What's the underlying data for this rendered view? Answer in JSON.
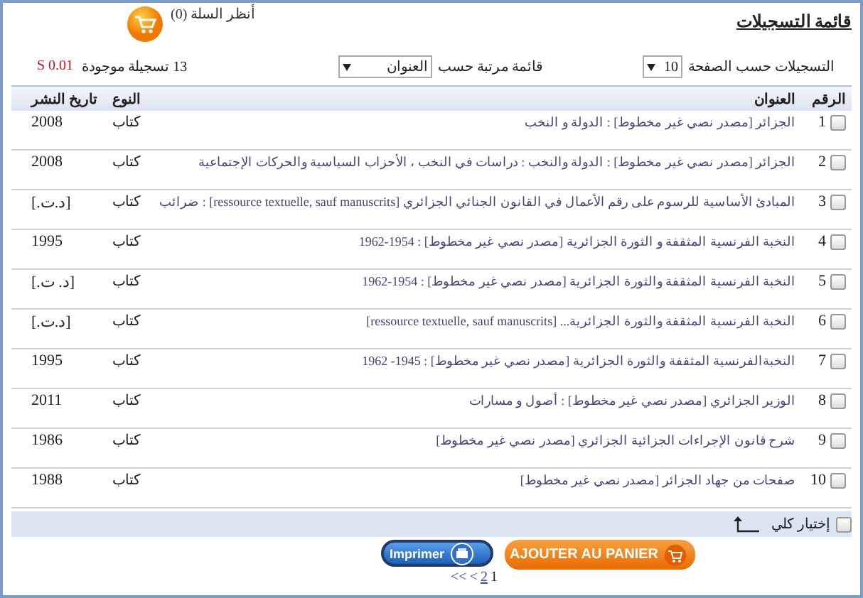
{
  "header": {
    "title": "قائمة التسجيلات",
    "cart_link": "أنظر السلة (0)"
  },
  "controls": {
    "per_page_label": "التسجيلات حسب الصفحة",
    "per_page_value": "10",
    "sort_label": "قائمة مرتبة حسب",
    "sort_value": "العنوان",
    "count": "13 تسجيلة موجودة",
    "time": "S 0.01"
  },
  "table": {
    "columns": [
      "الرقم",
      "العنوان",
      "النوع",
      "تاريخ النشر"
    ],
    "rows": [
      {
        "checked": false,
        "number": "1",
        "title": "الجزائر [مصدر نصي غير مخطوط] : الدولة و النخب",
        "type": "كتاب",
        "date": "2008"
      },
      {
        "checked": false,
        "number": "2",
        "title": "الجزائر [مصدر نصي غير مخطوط] : الدولة والنخب : دراسات في النخب ، الأحزاب السياسية والحركات الإجتماعية",
        "type": "كتاب",
        "date": "2008"
      },
      {
        "checked": false,
        "number": "3",
        "title": "المبادئ الأساسية للرسوم على رقم الأعمال في القانون الجنائي الجزائري [ressource textuelle, sauf manuscrits] : ضرائب",
        "type": "كتاب",
        "date": "[د.ت.]"
      },
      {
        "checked": false,
        "number": "4",
        "title": "النخبة الفرنسية المثقفة و الثورة الجزائرية [مصدر نصي غير مخطوط] : 1954-1962",
        "type": "كتاب",
        "date": "1995"
      },
      {
        "checked": false,
        "number": "5",
        "title": "النخبة الفرنسية المثقفة والثورة الجزائرية [مصدر نصي غير مخطوط] : 1954-1962",
        "type": "كتاب",
        "date": "[د. ت.]"
      },
      {
        "checked": false,
        "number": "6",
        "title": "النخبة الفرنسية المثقفة والثورة الجزائرية... [ressource textuelle, sauf manuscrits]",
        "type": "كتاب",
        "date": "[د.ت.]"
      },
      {
        "checked": false,
        "number": "7",
        "title": "النخبةالفرنسية المثقفة والثورة الجزائرية [مصدر نصي غير مخطوط] : 1945- 1962",
        "type": "كتاب",
        "date": "1995"
      },
      {
        "checked": false,
        "number": "8",
        "title": "الوزير الجزائري [مصدر نصي غير مخطوط] : أصول و مسارات",
        "type": "كتاب",
        "date": "2011"
      },
      {
        "checked": false,
        "number": "9",
        "title": "شرح قانون الإجراءات الجزائية الجزائري [مصدر نصي غير مخطوط]",
        "type": "كتاب",
        "date": "1986"
      },
      {
        "checked": false,
        "number": "10",
        "title": "صفحات من جهاد الجزائر [مصدر نصي غير مخطوط]",
        "type": "كتاب",
        "date": "1988"
      }
    ]
  },
  "footer": {
    "select_all": {
      "label": "إختيار كلي",
      "checked": false
    },
    "buttons": [
      {
        "kind": "cart",
        "label": "AJOUTER AU PANIER"
      },
      {
        "kind": "print",
        "label": "Imprimer"
      }
    ],
    "pagination": [
      {
        "label": "1",
        "selected": true
      },
      {
        "label": "2",
        "selected": false
      },
      {
        "label": "<",
        "selected": false
      },
      {
        "label": "<<",
        "selected": false
      }
    ]
  }
}
